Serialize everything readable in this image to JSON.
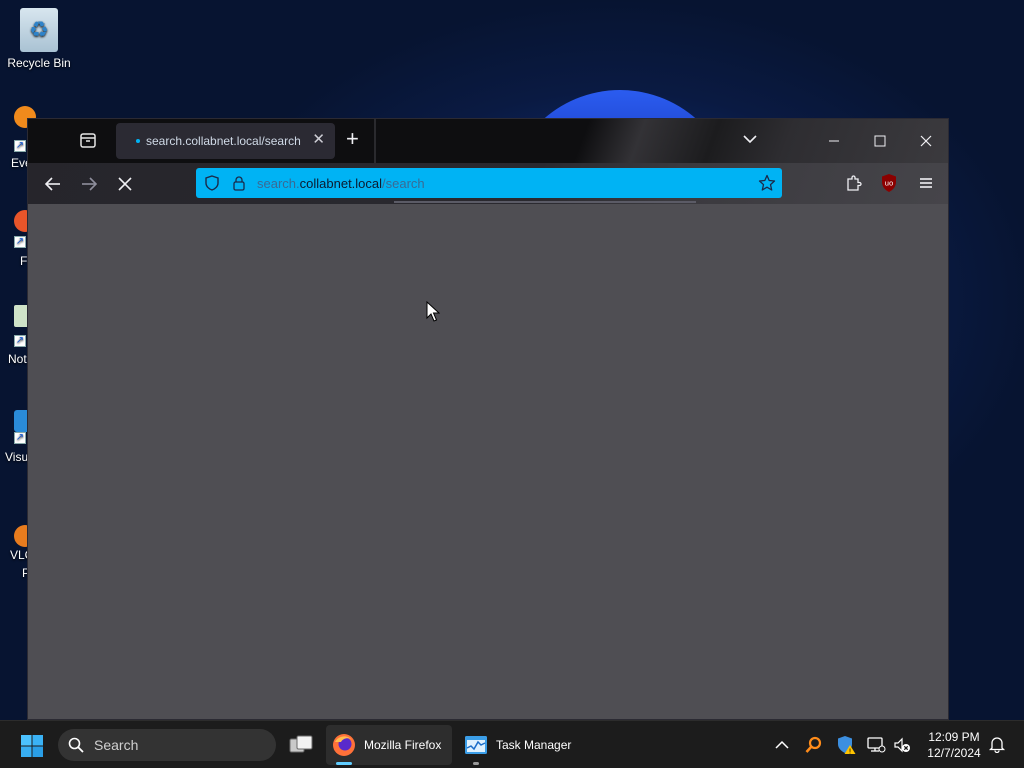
{
  "desktop": {
    "icons": [
      {
        "label": "Recycle Bin"
      },
      {
        "label": "Eve"
      },
      {
        "label": "F"
      },
      {
        "label": "Not"
      },
      {
        "label": "Visu"
      },
      {
        "label": "VLC"
      },
      {
        "label": "P"
      }
    ]
  },
  "browser": {
    "tab": {
      "title": "search.collabnet.local/search",
      "loading": true
    },
    "urlbar": {
      "prefix": "search.",
      "host": "collabnet.local",
      "path": "/search"
    },
    "icons": {
      "tab_overview": "tab-overview-icon",
      "tab_close": "close-icon",
      "new_tab": "plus-icon",
      "list_tabs": "chevron-down-icon",
      "back": "back-arrow-icon",
      "forward": "forward-arrow-icon",
      "stop": "stop-icon",
      "shield": "tracking-shield-icon",
      "lock": "lock-icon",
      "bookmark": "star-icon",
      "extensions": "puzzle-icon",
      "ublock": "ublock-origin-icon",
      "menu": "hamburger-menu-icon"
    }
  },
  "taskbar": {
    "search_label": "Search",
    "apps": [
      {
        "label": "Mozilla Firefox",
        "active": true
      },
      {
        "label": "Task Manager",
        "active": false
      }
    ],
    "clock": {
      "time": "12:09 PM",
      "date": "12/7/2024"
    }
  },
  "colors": {
    "urlbar_accent": "#00b3f4",
    "content_bg": "#4f4e53",
    "taskbar_bg": "#1c1c1c",
    "active_indicator": "#60cdff"
  }
}
